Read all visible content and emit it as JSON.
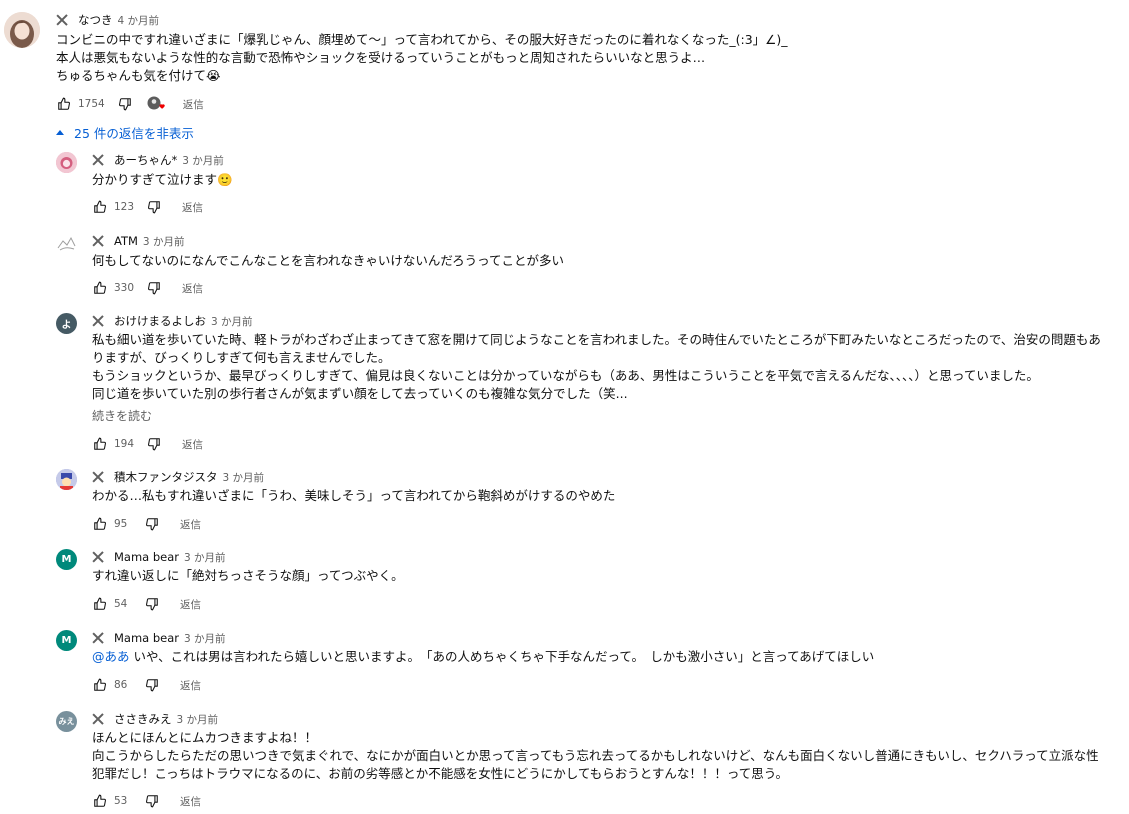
{
  "main": {
    "author": "なつき",
    "time": "4 か月前",
    "lines": [
      "コンビニの中ですれ違いざまに「爆乳じゃん、顔埋めて〜」って言われてから、その服大好きだったのに着れなくなった_(:3」∠)_",
      "本人は悪気もないような性的な言動で恐怖やショックを受けるっていうことがもっと周知されたらいいなと思うよ…",
      "ちゅるちゃんも気を付けて😭"
    ],
    "likes": "1754",
    "reply_label": "返信"
  },
  "replies_toggle": {
    "label": "25 件の返信を非表示"
  },
  "replies": [
    {
      "author": "あーちゃん*",
      "time": "3 か月前",
      "lines": [
        "分かりすぎて泣けます🙂"
      ],
      "likes": "123",
      "reply_label": "返信",
      "avatar_color": "#e7a4b4",
      "avatar_text": ""
    },
    {
      "author": "ATM",
      "time": "3 か月前",
      "lines": [
        "何もしてないのになんでこんなことを言われなきゃいけないんだろうってことが多い"
      ],
      "likes": "330",
      "reply_label": "返信",
      "avatar_color": "#ffffff",
      "avatar_text": ""
    },
    {
      "author": "おけけまるよしお",
      "time": "3 か月前",
      "lines": [
        "私も細い道を歩いていた時、軽トラがわざわざ止まってきて窓を開けて同じようなことを言われました。その時住んでいたところが下町みたいなところだったので、治安の問題もあ",
        "りますが、びっくりしすぎて何も言えませんでした。",
        "もうショックというか、最早びっくりしすぎて、偏見は良くないことは分かっていながらも（ああ、男性はこういうことを平気で言えるんだな、、、、）と思っていました。",
        "同じ道を歩いていた別の歩行者さんが気まずい顔をして去っていくのも複雑な気分でした（笑..."
      ],
      "read_more": "続きを読む",
      "likes": "194",
      "reply_label": "返信",
      "avatar_color": "#455a64",
      "avatar_text": "よ"
    },
    {
      "author": "積木ファンタジスタ",
      "time": "3 か月前",
      "lines": [
        "わかる…私もすれ違いざまに「うわ、美味しそう」って言われてから鞄斜めがけするのやめた"
      ],
      "likes": "95",
      "reply_label": "返信",
      "avatar_color": "#9fa8da",
      "avatar_text": ""
    },
    {
      "author": "Mama bear",
      "time": "3 か月前",
      "lines": [
        "すれ違い返しに「絶対ちっさそうな顔」ってつぶやく。"
      ],
      "likes": "54",
      "reply_label": "返信",
      "avatar_color": "#00897b",
      "avatar_text": "M"
    },
    {
      "author": "Mama bear",
      "time": "3 か月前",
      "mention": "@ああ",
      "lines": [
        "いや、これは男は言われたら嬉しいと思いますよ。　「あの人めちゃくちゃ下手なんだって。　しかも激小さい」と言ってあげてほしい"
      ],
      "likes": "86",
      "reply_label": "返信",
      "avatar_color": "#00897b",
      "avatar_text": "M"
    },
    {
      "author": "ささきみえ",
      "time": "3 か月前",
      "lines": [
        "ほんとにほんとにムカつきますよね！！",
        "向こうからしたらただの思いつきで気まぐれで、なにかが面白いとか思って言ってもう忘れ去ってるかもしれないけど、なんも面白くないし普通にきもいし、セクハラって立派な性",
        "犯罪だし！こっちはトラウマになるのに、お前の劣等感とか不能感を女性にどうにかしてもらおうとすんな！！！って思う。"
      ],
      "likes": "53",
      "reply_label": "返信",
      "avatar_color": "#78909c",
      "avatar_text": "みえ"
    }
  ],
  "icons": {
    "remove": "close-icon",
    "like": "thumbs-up-icon",
    "dislike": "thumbs-down-icon",
    "heart": "creator-heart-icon"
  },
  "colors": {
    "link": "#065fd4",
    "secondary_text": "#606060"
  }
}
